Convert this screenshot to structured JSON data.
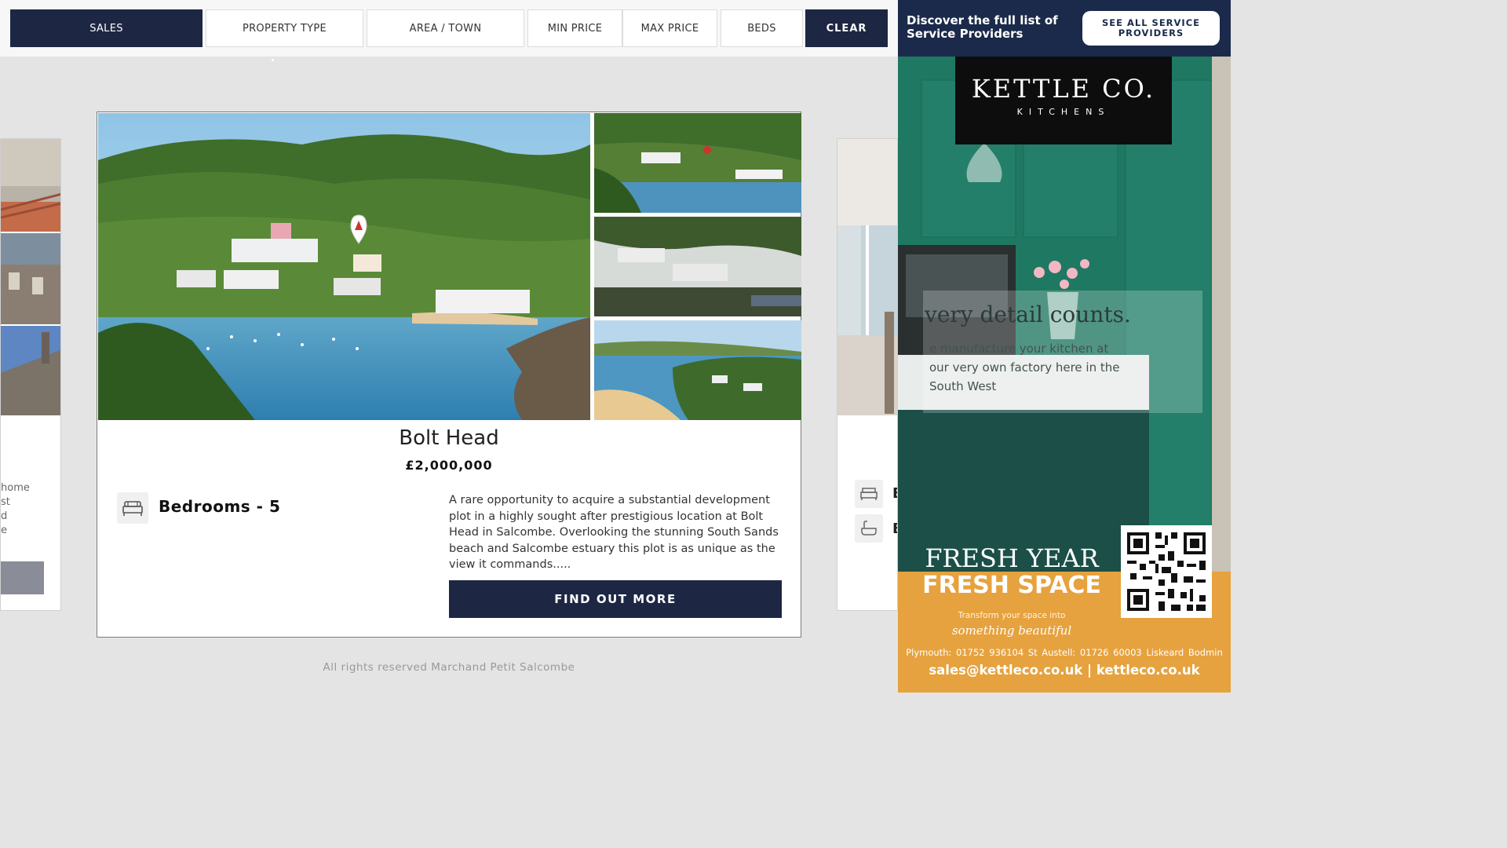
{
  "filters": {
    "sales": "SALES",
    "property_type": "PROPERTY TYPE",
    "area_town": "AREA / TOWN",
    "min_price": "MIN PRICE",
    "max_price": "MAX PRICE",
    "beds": "BEDS",
    "clear": "CLEAR"
  },
  "side_left": {
    "text_lines": [
      "home",
      "st",
      "d",
      "e"
    ]
  },
  "side_right": {
    "chars": [
      "B",
      "B"
    ]
  },
  "listing": {
    "title": "Bolt Head",
    "price": "£2,000,000",
    "bedrooms_label": "Bedrooms - 5",
    "description": "A rare opportunity to acquire a substantial development plot in a highly sought after prestigious location at Bolt Head in Salcombe. Overlooking the stunning South Sands beach and Salcombe estuary this plot is as unique as the view it commands.....",
    "cta": "FIND OUT MORE"
  },
  "footer": "All rights reserved Marchand Petit Salcombe",
  "service_panel": {
    "heading": "Discover the full list of Service Providers",
    "button": "SEE ALL SERVICE PROVIDERS"
  },
  "advert": {
    "brand": "KETTLE CO.",
    "brand_sub": "KITCHENS",
    "quote_heading": "very detail counts.",
    "quote_body": "e manufacture your kitchen at our very own factory here in the South West",
    "headline_1": "FRESH YEAR",
    "headline_2": "FRESH SPACE",
    "tagline": "Transform your space into",
    "tagline_script": "something beautiful",
    "locations": "Plymouth: 01752 936104   St Austell: 01726 60003   Liskeard   Bodmin",
    "contact": "sales@kettleco.co.uk | kettleco.co.uk"
  },
  "colors": {
    "navy": "#1d2744",
    "panel_navy": "#1b2a4a",
    "ad_green": "#1f7862",
    "ad_orange": "#e6a23e"
  }
}
